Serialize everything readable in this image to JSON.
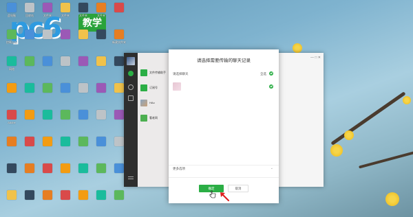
{
  "watermark": {
    "brand": "pc6",
    "tag": "教学"
  },
  "desktop_icons": [
    "此电脑",
    "回收站",
    "文件夹",
    "文件夹",
    "文件夹",
    "文件夹",
    "",
    "控制面板",
    "",
    "",
    "",
    "",
    "",
    "新建文件夹",
    "网络",
    "",
    "",
    "",
    "",
    "",
    "",
    "",
    "",
    "",
    "",
    "",
    "",
    "",
    "Adobe",
    "",
    "",
    "",
    "",
    "",
    "",
    "",
    "",
    "",
    "",
    "",
    "",
    "",
    "",
    "",
    "",
    "",
    "",
    "",
    "",
    "",
    "",
    "",
    "",
    "",
    "",
    ""
  ],
  "wechat": {
    "chats": [
      {
        "name": "文件传输助手"
      },
      {
        "name": "订阅号"
      },
      {
        "name": "HAo"
      },
      {
        "name": "看老网"
      }
    ]
  },
  "modal": {
    "title": "请选择需要传输的聊天记录",
    "select_label": "请选择聊天",
    "select_all": "全选",
    "more_options": "更多选项",
    "confirm": "确定",
    "cancel": "取消"
  },
  "colors": {
    "accent": "#2bae45"
  }
}
